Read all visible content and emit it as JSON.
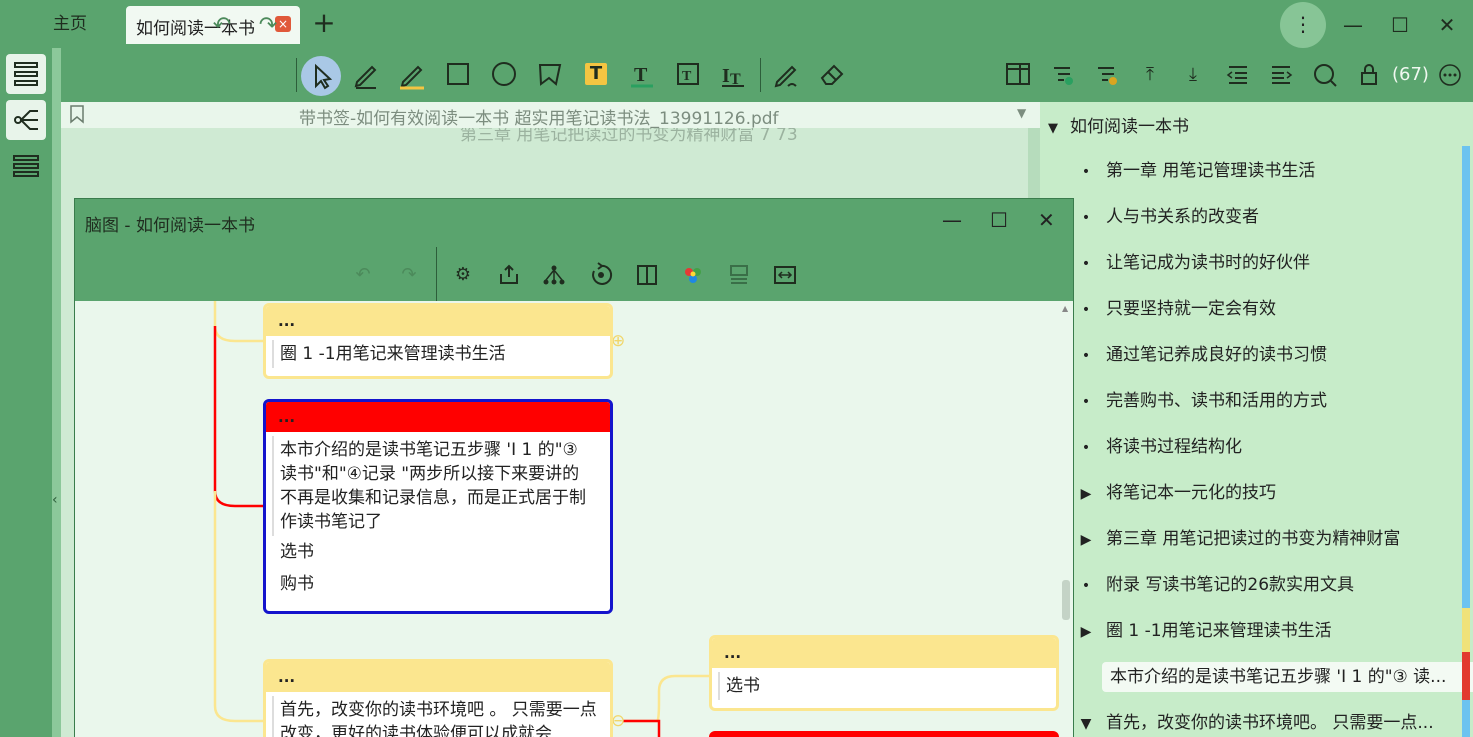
{
  "tabs": {
    "home": "主页",
    "active": "如何阅读一本书",
    "close": "×",
    "new": "+"
  },
  "window": {
    "more": "⋮",
    "minimize": "—",
    "maximize": "☐",
    "close": "✕"
  },
  "pdf": {
    "filename": "带书签-如何有效阅读一本书  超实用笔记读书法_13991126.pdf",
    "ghost_heading": "第三章   用笔记把读过的书变为精神财富      7     73"
  },
  "right": {
    "count": "(67)",
    "root": "如何阅读一本书",
    "items": [
      {
        "mark": "•",
        "label": "第一章  用笔记管理读书生活"
      },
      {
        "mark": "•",
        "label": "人与书关系的改变者"
      },
      {
        "mark": "•",
        "label": "让笔记成为读书时的好伙伴"
      },
      {
        "mark": "•",
        "label": "只要坚持就一定会有效"
      },
      {
        "mark": "•",
        "label": "通过笔记养成良好的读书习惯"
      },
      {
        "mark": "•",
        "label": "完善购书、读书和活用的方式"
      },
      {
        "mark": "•",
        "label": "将读书过程结构化"
      },
      {
        "mark": "▶",
        "label": "将笔记本一元化的技巧"
      },
      {
        "mark": "▶",
        "label": "第三章  用笔记把读过的书变为精神财富"
      },
      {
        "mark": "•",
        "label": "附录  写读书笔记的26款实用文具"
      },
      {
        "mark": "▶",
        "label": "圈 1 -1用笔记来管理读书生活"
      },
      {
        "mark": "•",
        "label": "本市介绍的是读书笔记五步骤 'I 1 的\"③ 读..."
      },
      {
        "mark": "▼",
        "label": "首先，改变你的读书环境吧。 只需要一点..."
      }
    ]
  },
  "mindmap": {
    "title": "脑图 - 如何阅读一本书",
    "node1": {
      "head": "...",
      "text": "圈 1 -1用笔记来管理读书生活"
    },
    "node2": {
      "head": "...",
      "text": "本市介绍的是读书笔记五步骤 'I 1 的\"③ 读书\"和\"④记录 \"两步所以接下来要讲的 不再是收集和记录信息，而是正式居于制 作读书笔记了",
      "sub1": "选书",
      "sub2": "购书"
    },
    "node3": {
      "head": "...",
      "text": "首先，改变你的读书环境吧 。 只需要一点改变，更好的读书体验便可以成就会"
    },
    "node4": {
      "head": "...",
      "text": "选书"
    },
    "add_icon": "⊕",
    "collapse_icon": "⊖"
  },
  "colors": {
    "accent": "#5aa46e",
    "panel": "#c7ecc9",
    "canvas": "#eaf7ec",
    "red": "#ff0000",
    "blue": "#1414cc",
    "yellow": "#fbe68f"
  }
}
